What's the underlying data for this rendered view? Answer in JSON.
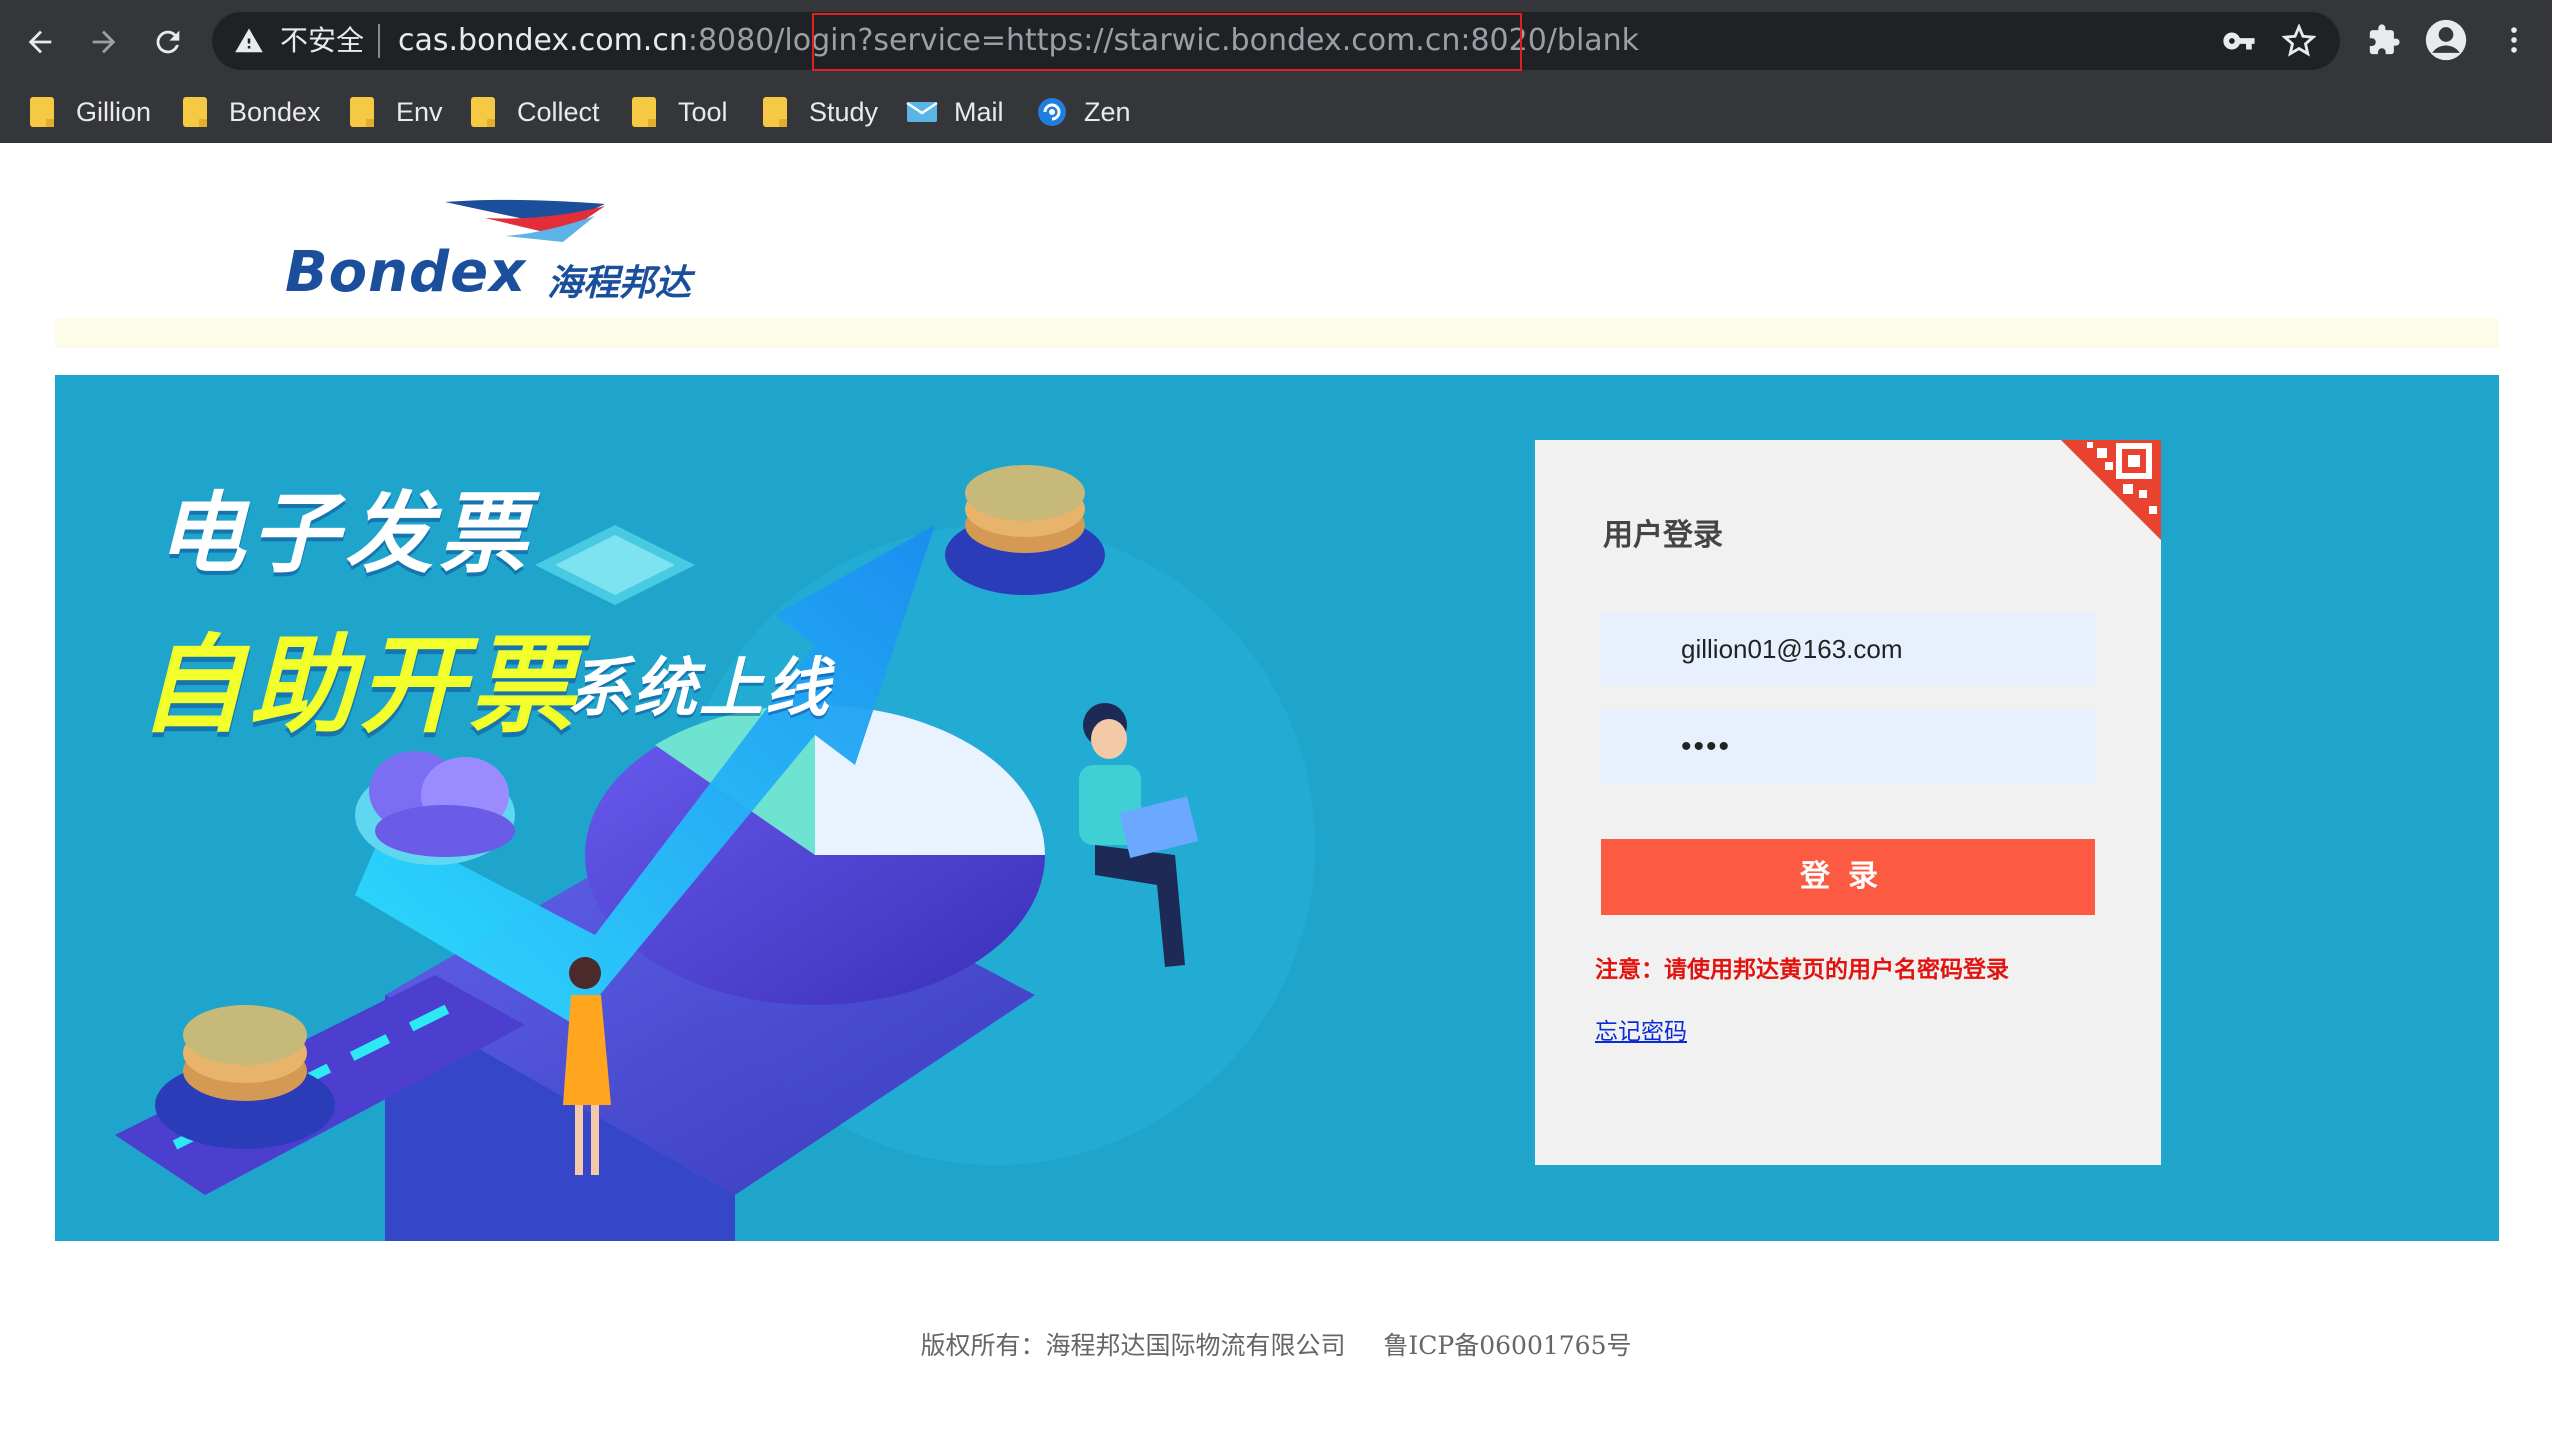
{
  "browser": {
    "security_label": "不安全",
    "url_host": "cas.bondex.com.cn",
    "url_rest": ":8080/login?service=https://starwic.bondex.com.cn:8020/blank",
    "bookmarks": [
      {
        "label": "Gillion",
        "icon": "folder-icon"
      },
      {
        "label": "Bondex",
        "icon": "folder-icon"
      },
      {
        "label": "Env",
        "icon": "folder-icon"
      },
      {
        "label": "Collect",
        "icon": "folder-icon"
      },
      {
        "label": "Tool",
        "icon": "folder-icon"
      },
      {
        "label": "Study",
        "icon": "folder-icon"
      },
      {
        "label": "Mail",
        "icon": "mail-icon"
      },
      {
        "label": "Zen",
        "icon": "zen-icon"
      }
    ]
  },
  "logo": {
    "text": "Bondex",
    "cn": "海程邦达"
  },
  "banner": {
    "headline1": "电子发票",
    "headline2": "自助开票",
    "headline3": "系统上线"
  },
  "login": {
    "title": "用户登录",
    "username": "gillion01@163.com",
    "password": "••••",
    "button": "登录",
    "notice": "注意：请使用邦达黄页的用户名密码登录",
    "forgot": "忘记密码"
  },
  "footer": {
    "copyright": "版权所有：海程邦达国际物流有限公司",
    "icp": "鲁ICP备06001765号"
  },
  "colors": {
    "chrome_bg": "#35363a",
    "banner_bg": "#1fa5cc",
    "login_button": "#fd5a43",
    "notice_red": "#e2130e",
    "brand_blue": "#1b4f9c"
  }
}
